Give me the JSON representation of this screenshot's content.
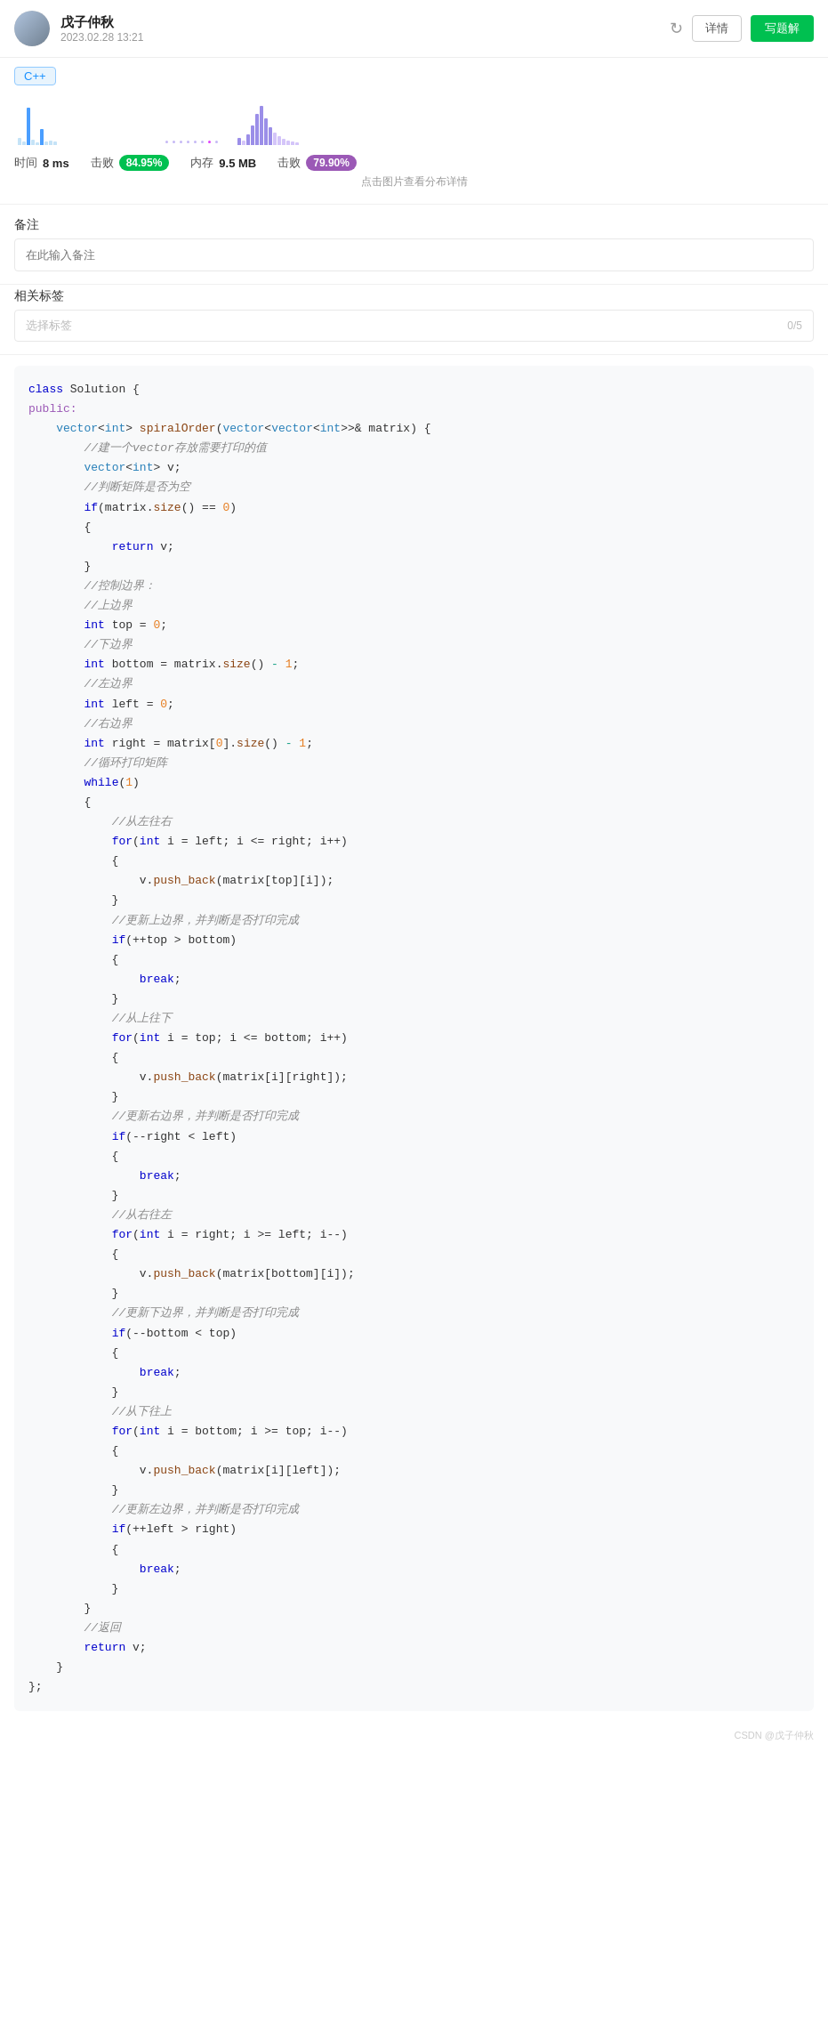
{
  "header": {
    "username": "戊子仲秋",
    "date": "2023.02.28 13:21",
    "refresh_label": "↻",
    "detail_label": "详情",
    "solve_label": "写题解"
  },
  "lang_tag": "C++",
  "performance": {
    "time_label": "时间",
    "time_value": "8 ms",
    "beat_label": "击败",
    "beat_value_green": "84.95%",
    "memory_label": "内存",
    "memory_value": "9.5 MB",
    "beat_label2": "击败",
    "beat_value_purple": "79.90%",
    "chart_detail": "点击图片查看分布详情"
  },
  "note": {
    "label": "备注",
    "placeholder": "在此输入备注"
  },
  "tags": {
    "label": "相关标签",
    "placeholder": "选择标签",
    "count": "0/5"
  },
  "footer": {
    "csdn": "CSDN @戊子仲秋"
  }
}
